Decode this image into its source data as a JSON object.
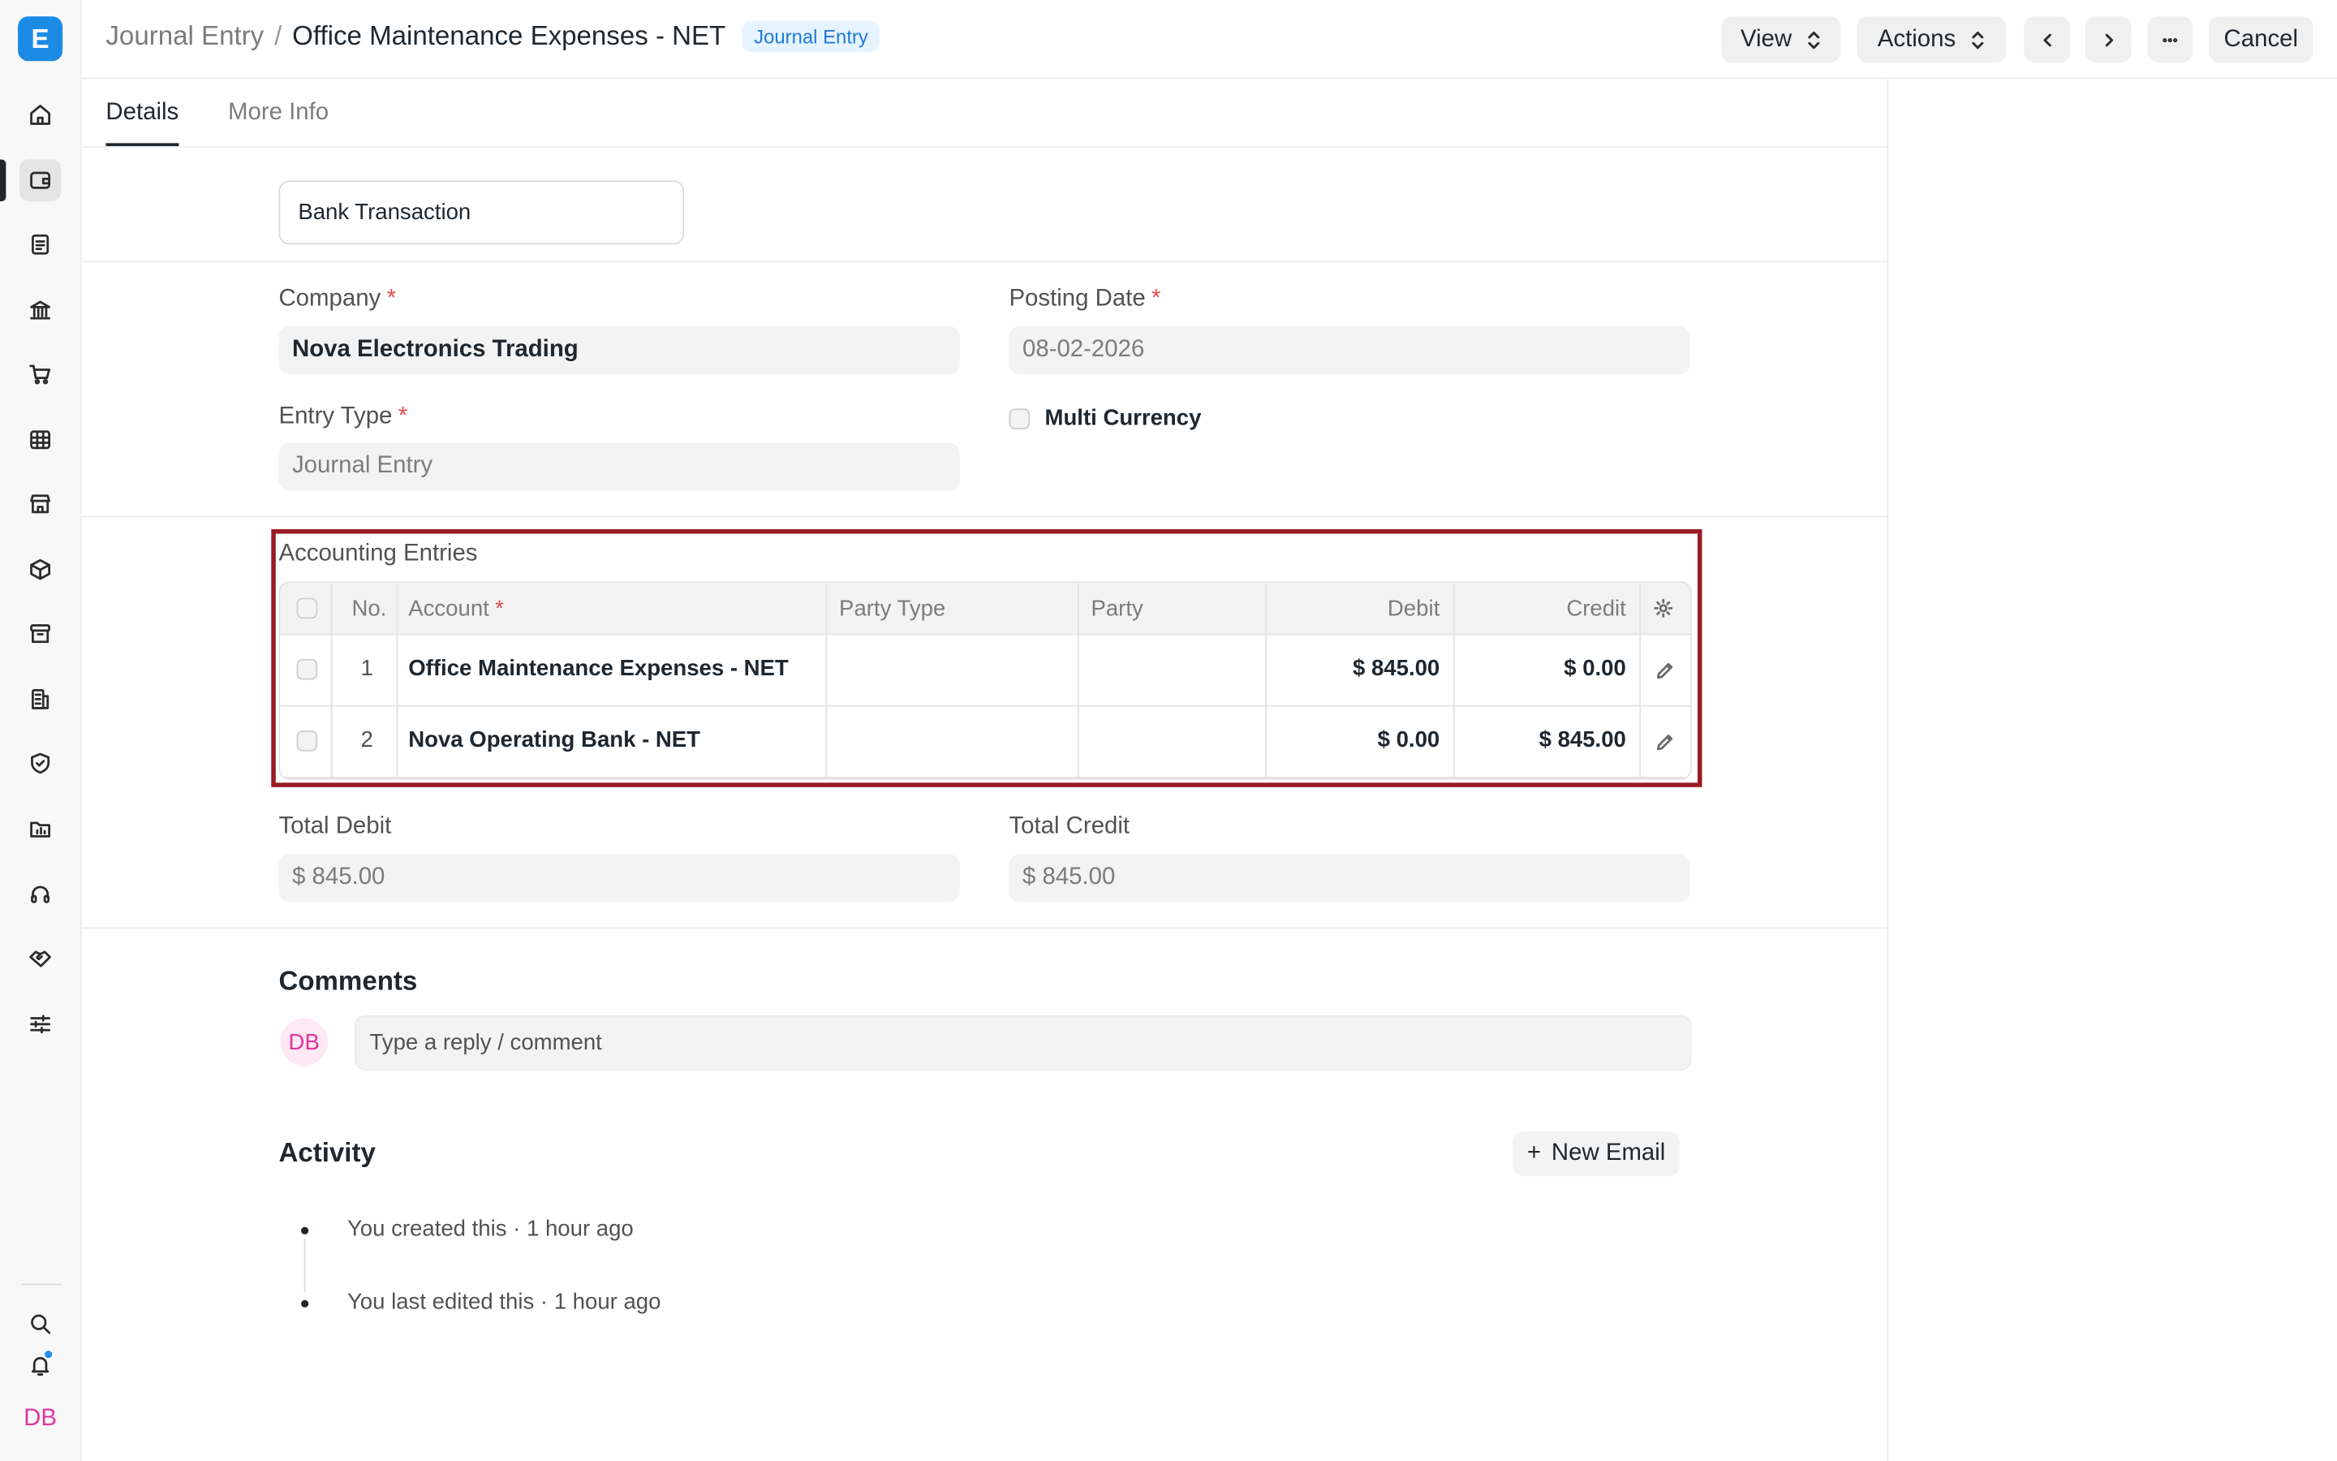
{
  "app": {
    "logo_letter": "E"
  },
  "sidebar": {
    "items": [
      {
        "icon": "home-icon"
      },
      {
        "icon": "wallet-icon"
      },
      {
        "icon": "document-icon"
      },
      {
        "icon": "bank-icon"
      },
      {
        "icon": "cart-icon"
      },
      {
        "icon": "table-icon"
      },
      {
        "icon": "store-icon"
      },
      {
        "icon": "package-icon"
      },
      {
        "icon": "archive-icon"
      },
      {
        "icon": "building-icon"
      },
      {
        "icon": "shield-icon"
      },
      {
        "icon": "folder-chart-icon"
      },
      {
        "icon": "headset-icon"
      },
      {
        "icon": "handshake-icon"
      },
      {
        "icon": "sliders-icon"
      }
    ],
    "bottom": {
      "search": "search-icon",
      "notifications": "bell-icon",
      "avatar_initials": "DB"
    }
  },
  "header": {
    "breadcrumb_parent": "Journal Entry",
    "separator": "/",
    "title": "Office Maintenance Expenses - NET",
    "status_badge": "Journal Entry",
    "view_label": "View",
    "actions_label": "Actions",
    "cancel_label": "Cancel"
  },
  "tabs": [
    {
      "label": "Details",
      "active": true
    },
    {
      "label": "More Info",
      "active": false
    }
  ],
  "form": {
    "voucher_type_value": "Bank Transaction",
    "company_label": "Company",
    "company_value": "Nova Electronics Trading",
    "posting_date_label": "Posting Date",
    "posting_date_value": "08-02-2026",
    "entry_type_label": "Entry Type",
    "entry_type_value": "Journal Entry",
    "multi_currency_label": "Multi Currency",
    "required_mark": "*"
  },
  "accounts_table": {
    "title": "Accounting Entries",
    "headers": {
      "no": "No.",
      "account": "Account",
      "party_type": "Party Type",
      "party": "Party",
      "debit": "Debit",
      "credit": "Credit"
    },
    "rows": [
      {
        "no": "1",
        "account": "Office Maintenance Expenses - NET",
        "party_type": "",
        "party": "",
        "debit": "$ 845.00",
        "credit": "$ 0.00"
      },
      {
        "no": "2",
        "account": "Nova Operating Bank - NET",
        "party_type": "",
        "party": "",
        "debit": "$ 0.00",
        "credit": "$ 845.00"
      }
    ]
  },
  "totals": {
    "total_debit_label": "Total Debit",
    "total_debit_value": "$ 845.00",
    "total_credit_label": "Total Credit",
    "total_credit_value": "$ 845.00"
  },
  "comments": {
    "heading": "Comments",
    "avatar_initials": "DB",
    "placeholder": "Type a reply / comment"
  },
  "activity": {
    "heading": "Activity",
    "new_email_label": "New Email",
    "items": [
      "You created this · 1 hour ago",
      "You last edited this · 1 hour ago"
    ]
  },
  "colors": {
    "accent": "#2490ef",
    "highlight_border": "#9a1b23",
    "required": "#e24c4c",
    "avatar": "#e0359f"
  }
}
